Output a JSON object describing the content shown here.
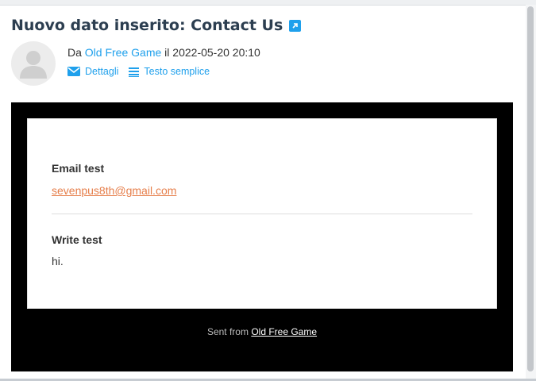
{
  "message": {
    "subject": "Nuovo dato inserito: Contact Us",
    "from_prefix": "Da",
    "sender": "Old Free Game",
    "date_prefix": "il",
    "datetime": "2022-05-20 20:10",
    "actions": {
      "details": "Dettagli",
      "plain_text": "Testo semplice"
    }
  },
  "email_body": {
    "fields": [
      {
        "label": "Email test",
        "value": "sevenpus8th@gmail.com"
      },
      {
        "label": "Write test",
        "value": "hi."
      }
    ],
    "footer_prefix": "Sent from",
    "footer_link": "Old Free Game"
  },
  "colors": {
    "accent": "#1fa0ec",
    "email_link": "#e67e4a",
    "mail_background": "#000000"
  },
  "icons": [
    "external-link-icon",
    "avatar-icon",
    "envelope-icon",
    "list-icon"
  ]
}
